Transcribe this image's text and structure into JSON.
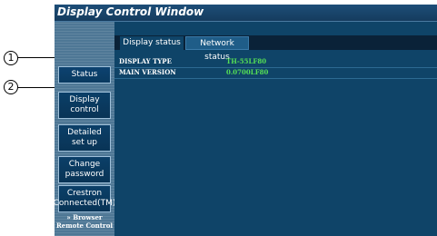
{
  "window": {
    "title": "Display Control Window"
  },
  "callouts": [
    "1",
    "2"
  ],
  "sidebar": {
    "items": [
      {
        "label": "Status"
      },
      {
        "label": "Display\ncontrol"
      },
      {
        "label": "Detailed\nset up"
      },
      {
        "label": "Change\npassword"
      },
      {
        "label": "Crestron\nConnected(TM)"
      }
    ],
    "browser_link": "» Browser\nRemote Control"
  },
  "tabs": [
    {
      "label": "Display status",
      "active": true
    },
    {
      "label": "Network status",
      "active": false
    }
  ],
  "status": {
    "rows": [
      {
        "label": "DISPLAY TYPE",
        "value": "TH-55LF80"
      },
      {
        "label": "MAIN VERSION",
        "value": "0.0700LF80"
      }
    ]
  },
  "colors": {
    "value_text": "#55e055",
    "panel_bg": "#0f4468",
    "sidebar_bg": "#4e7795"
  }
}
